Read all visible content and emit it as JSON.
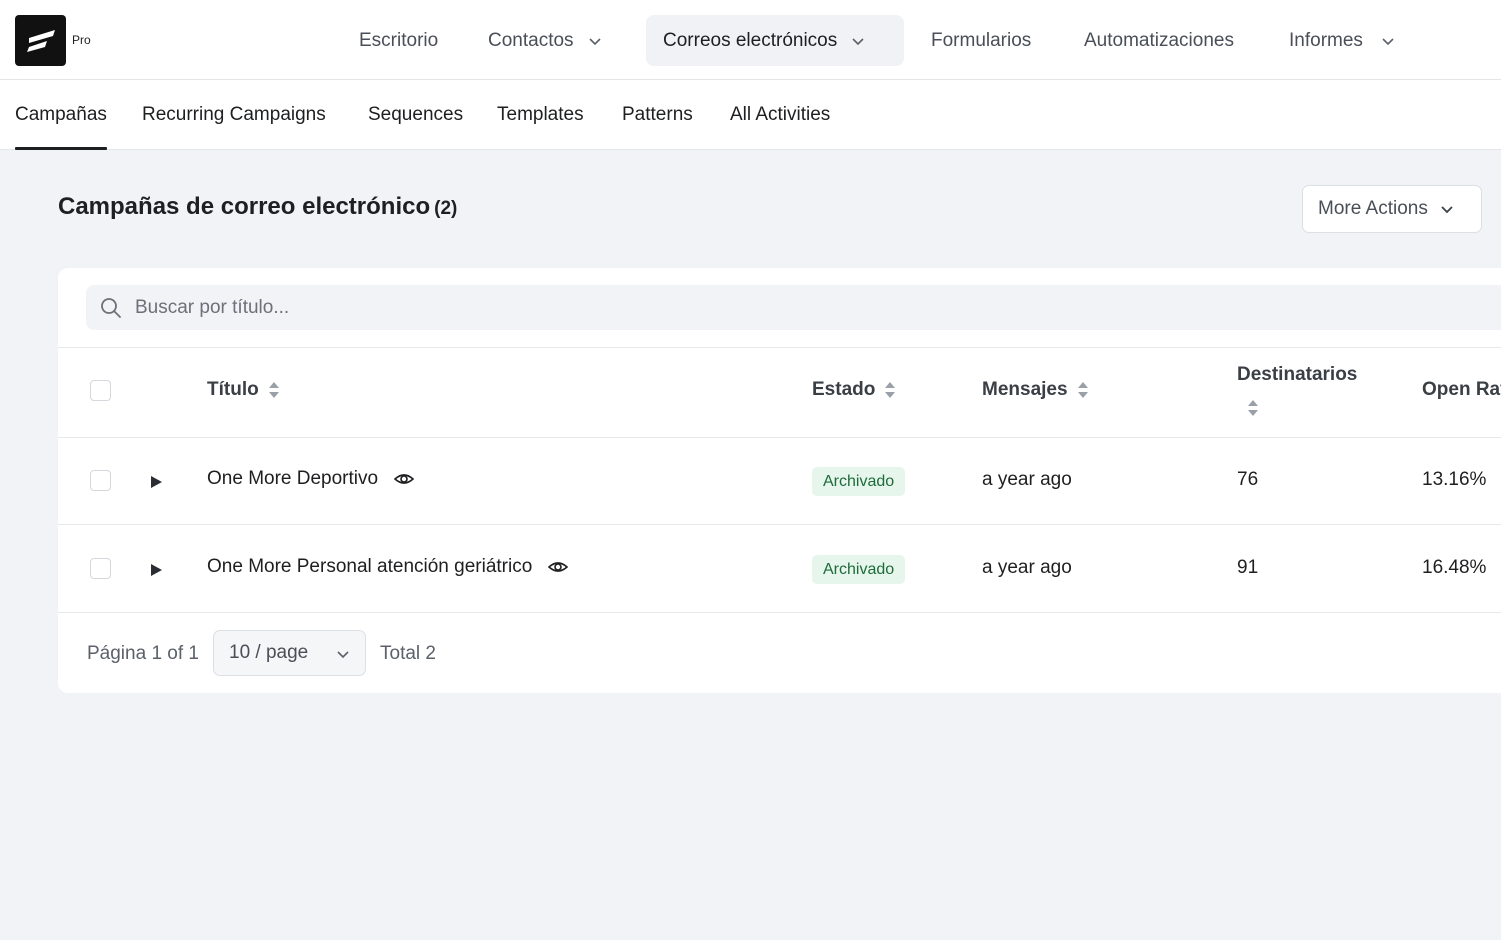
{
  "app": {
    "logo_badge": "Pro"
  },
  "main_nav": {
    "items": [
      {
        "label": "Escritorio"
      },
      {
        "label": "Contactos"
      },
      {
        "label": "Correos electrónicos"
      },
      {
        "label": "Formularios"
      },
      {
        "label": "Automatizaciones"
      },
      {
        "label": "Informes"
      }
    ],
    "active": "Correos electrónicos"
  },
  "sub_nav": {
    "items": [
      {
        "label": "Campañas"
      },
      {
        "label": "Recurring Campaigns"
      },
      {
        "label": "Sequences"
      },
      {
        "label": "Templates"
      },
      {
        "label": "Patterns"
      },
      {
        "label": "All Activities"
      }
    ],
    "active": "Campañas"
  },
  "page": {
    "title": "Campañas de correo electrónico",
    "count": "(2)",
    "more_actions_label": "More Actions"
  },
  "search": {
    "placeholder": "Buscar por título..."
  },
  "table": {
    "headers": {
      "title": "Título",
      "status": "Estado",
      "messages": "Mensajes",
      "recipients": "Destinatarios",
      "open_rate": "Open Rate"
    },
    "rows": [
      {
        "title": "One More Deportivo",
        "status": "Archivado",
        "messages": "a year ago",
        "recipients": "76",
        "open_rate": "13.16%"
      },
      {
        "title": "One More Personal atención geriátrico",
        "status": "Archivado",
        "messages": "a year ago",
        "recipients": "91",
        "open_rate": "16.48%"
      }
    ]
  },
  "pagination": {
    "page_label": "Página 1 of 1",
    "page_size": "10 / page",
    "total": "Total 2"
  },
  "icons": {
    "logo": "fluent-logo-icon",
    "chevron": "chevron-down-icon",
    "search": "search-icon",
    "sort": "sort-icon",
    "expand": "expand-arrow-icon",
    "preview": "eye-icon"
  },
  "colors": {
    "badge_bg": "#e7f6ec",
    "badge_text": "#1d6b3a",
    "page_bg": "#f1f3f6",
    "active_nav_bg": "#f0f2f6"
  }
}
